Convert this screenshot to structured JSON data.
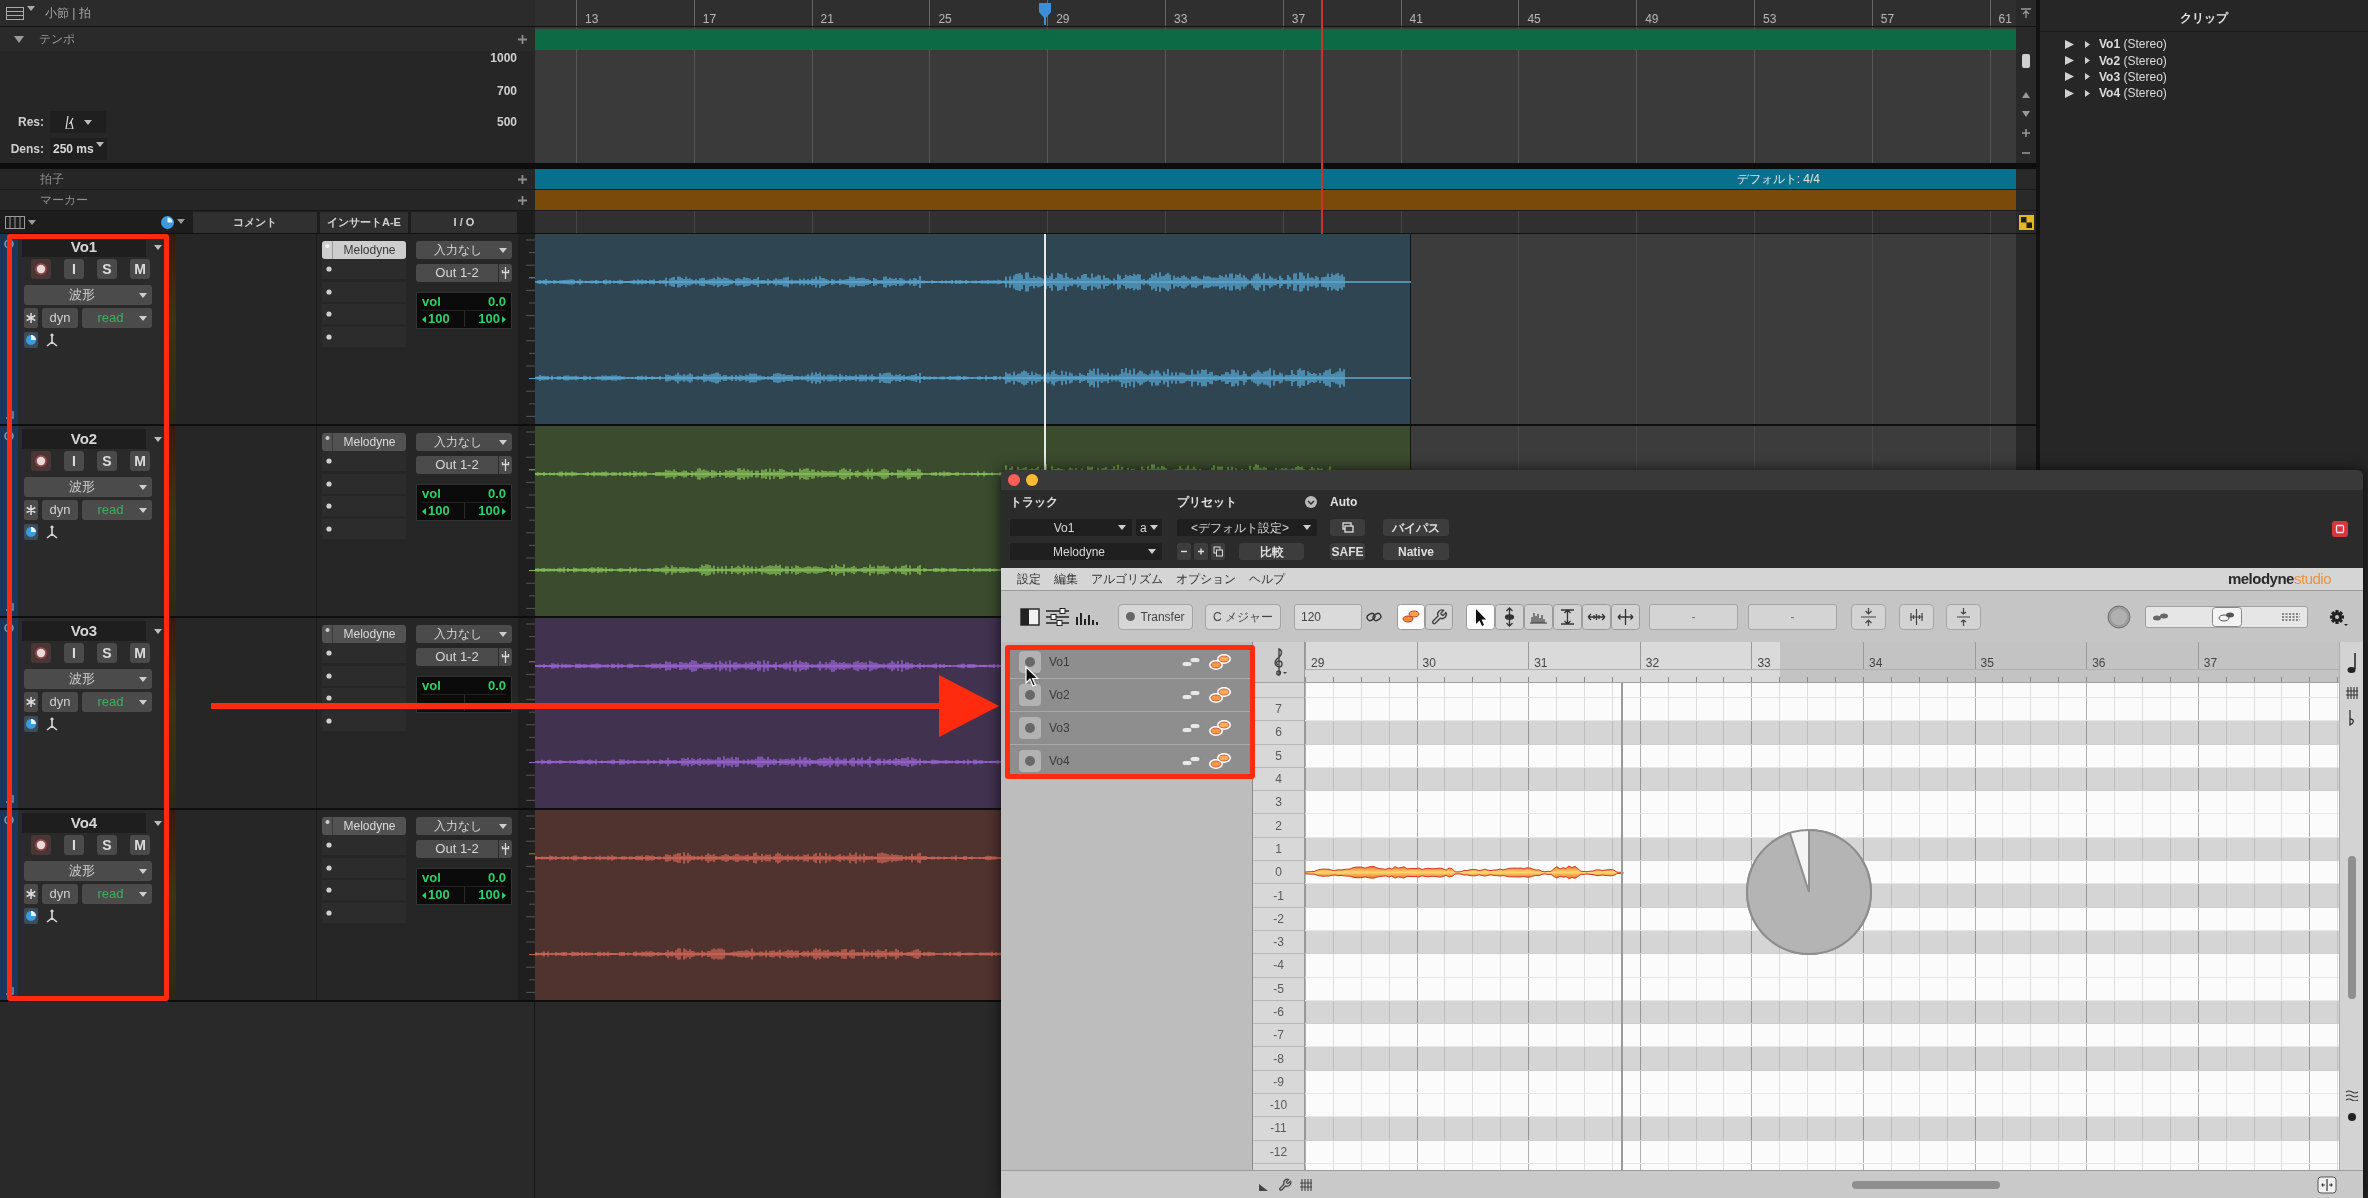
{
  "edit_window": {
    "ruler": {
      "label": "小節 | 拍",
      "bars": [
        "13",
        "17",
        "21",
        "25",
        "29",
        "33",
        "37",
        "41",
        "45",
        "49",
        "53",
        "57",
        "61"
      ]
    },
    "tempo": {
      "label": "テンポ",
      "expanded": true,
      "scale": [
        "1000",
        "700",
        "500"
      ],
      "res_label": "Res:",
      "dens_label": "Dens:",
      "dens_value": "250 ms"
    },
    "meter": {
      "label": "拍子",
      "value": "デフォルト: 4/4"
    },
    "markers": {
      "label": "マーカー"
    },
    "columns": [
      "コメント",
      "インサートA-E",
      "I / O"
    ],
    "tracks": [
      {
        "name": "Vo1",
        "color": "#5aa8d4",
        "buttons": [
          "I",
          "S",
          "M"
        ],
        "view": "波形",
        "automation": "dyn",
        "mode": "read",
        "insert": "Melodyne",
        "insert_selected": true,
        "input": "入力なし",
        "output": "Out 1-2",
        "vol_label": "vol",
        "vol": "0.0",
        "pan": [
          "100",
          "100"
        ]
      },
      {
        "name": "Vo2",
        "color": "#86bf58",
        "buttons": [
          "I",
          "S",
          "M"
        ],
        "view": "波形",
        "automation": "dyn",
        "mode": "read",
        "insert": "Melodyne",
        "insert_selected": false,
        "input": "入力なし",
        "output": "Out 1-2",
        "vol_label": "vol",
        "vol": "0.0",
        "pan": [
          "100",
          "100"
        ]
      },
      {
        "name": "Vo3",
        "color": "#9a64d2",
        "buttons": [
          "I",
          "S",
          "M"
        ],
        "view": "波形",
        "automation": "dyn",
        "mode": "read",
        "insert": "Melodyne",
        "insert_selected": false,
        "input": "入力なし",
        "output": "Out 1-2",
        "vol_label": "vol",
        "vol": "0.0"
      },
      {
        "name": "Vo4",
        "color": "#cf6658",
        "buttons": [
          "I",
          "S",
          "M"
        ],
        "view": "波形",
        "automation": "dyn",
        "mode": "read",
        "insert": "Melodyne",
        "insert_selected": false,
        "input": "入力なし",
        "output": "Out 1-2",
        "vol_label": "vol",
        "vol": "0.0",
        "pan": [
          "100",
          "100"
        ]
      }
    ]
  },
  "clips": {
    "title": "クリップ",
    "items": [
      "**Vo1** (Stereo)",
      "**Vo2** (Stereo)",
      "**Vo3** (Stereo)",
      "**Vo4** (Stereo)"
    ]
  },
  "plugin_window": {
    "header": {
      "track_label": "トラック",
      "preset_label": "プリセット",
      "auto_label": "Auto",
      "track": "Vo1",
      "variant": "a",
      "preset": "<デフォルト設定>",
      "plugin": "Melodyne",
      "compare": "比較",
      "bypass": "バイパス",
      "safe": "SAFE",
      "native": "Native"
    },
    "menu": [
      "設定",
      "編集",
      "アルゴリズム",
      "オプション",
      "ヘルプ"
    ],
    "logo": {
      "name": "melodyne",
      "edition": "studio"
    },
    "toolbar": {
      "transfer": "Transfer",
      "key": "C メジャー",
      "tempo": "120",
      "edit_modes": [
        {
          "kind": "notes",
          "selected": true
        },
        {
          "kind": "wrench",
          "selected": false
        }
      ],
      "tools": [
        {
          "kind": "pointer",
          "selected": true
        },
        {
          "kind": "pitch",
          "selected": false
        },
        {
          "kind": "amplitude",
          "selected": false
        },
        {
          "kind": "formant",
          "selected": false
        },
        {
          "kind": "time",
          "selected": false
        },
        {
          "kind": "split",
          "selected": false
        }
      ],
      "fields": [
        "-",
        "-"
      ],
      "display_slider": {
        "level": 0.5
      }
    },
    "tracks": [
      "Vo1",
      "Vo2",
      "Vo3",
      "Vo4"
    ],
    "bars": [
      "29",
      "30",
      "31",
      "32",
      "33",
      "34",
      "35",
      "36",
      "37"
    ],
    "pitch_rows": [
      {
        "label": "7",
        "shaded": false
      },
      {
        "label": "6",
        "shaded": true
      },
      {
        "label": "5",
        "shaded": false
      },
      {
        "label": "4",
        "shaded": true
      },
      {
        "label": "3",
        "shaded": false
      },
      {
        "label": "2",
        "shaded": false
      },
      {
        "label": "1",
        "shaded": true
      },
      {
        "label": "0",
        "shaded": false
      },
      {
        "label": "-1",
        "shaded": true
      },
      {
        "label": "-2",
        "shaded": false
      },
      {
        "label": "-3",
        "shaded": true
      },
      {
        "label": "-4",
        "shaded": false
      },
      {
        "label": "-5",
        "shaded": false
      },
      {
        "label": "-6",
        "shaded": true
      },
      {
        "label": "-7",
        "shaded": false
      },
      {
        "label": "-8",
        "shaded": true
      },
      {
        "label": "-9",
        "shaded": false
      },
      {
        "label": "-10",
        "shaded": false
      },
      {
        "label": "-11",
        "shaded": true
      },
      {
        "label": "-12",
        "shaded": false
      }
    ],
    "analysis": {
      "level": 0.95
    }
  }
}
